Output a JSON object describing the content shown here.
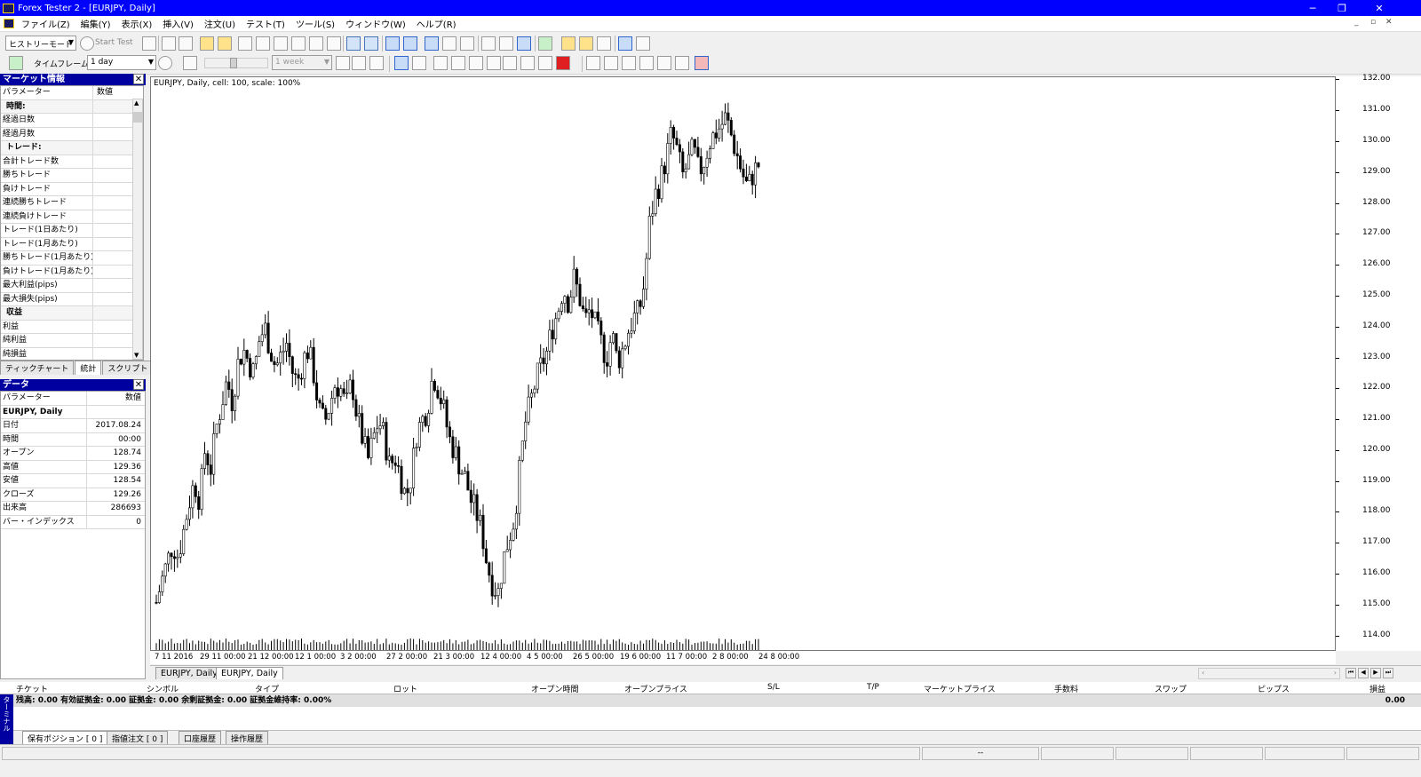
{
  "window": {
    "title": "Forex Tester 2 - [EURJPY, Daily]",
    "minimize": "─",
    "restore": "❐",
    "close": "✕"
  },
  "menu": [
    "ファイル(Z)",
    "編集(Y)",
    "表示(X)",
    "挿入(V)",
    "注文(U)",
    "テスト(T)",
    "ツール(S)",
    "ウィンドウ(W)",
    "ヘルプ(R)"
  ],
  "toolbar": {
    "mode": "ヒストリーモード",
    "start_test": "Start Test",
    "timeframe_label": "タイムフレーム:",
    "timeframe": "1 day",
    "period": "1 week"
  },
  "market_panel": {
    "title": "マーケット情報",
    "col_param": "パラメーター",
    "col_value": "数値",
    "rows": [
      {
        "label": "時間:",
        "section": true
      },
      {
        "label": "経過日数"
      },
      {
        "label": "経過月数"
      },
      {
        "label": "トレード:",
        "section": true
      },
      {
        "label": "合計トレード数"
      },
      {
        "label": "勝ちトレード"
      },
      {
        "label": "負けトレード"
      },
      {
        "label": "連続勝ちトレード"
      },
      {
        "label": "連続負けトレード"
      },
      {
        "label": "トレード(1日あたり)"
      },
      {
        "label": "トレード(1月あたり)"
      },
      {
        "label": "勝ちトレード(1月あたり)"
      },
      {
        "label": "負けトレード(1月あたり)"
      },
      {
        "label": "最大利益(pips)"
      },
      {
        "label": "最大損失(pips)"
      },
      {
        "label": "収益",
        "section": true
      },
      {
        "label": "利益"
      },
      {
        "label": "純利益"
      },
      {
        "label": "純損益"
      }
    ],
    "tabs": [
      "ティックチャート",
      "統計",
      "スクリプト"
    ]
  },
  "data_panel": {
    "title": "データ",
    "col_param": "パラメーター",
    "col_value": "数値",
    "symbol": "EURJPY, Daily",
    "rows": [
      {
        "label": "日付",
        "value": "2017.08.24"
      },
      {
        "label": "時間",
        "value": "00:00"
      },
      {
        "label": "オープン",
        "value": "128.74"
      },
      {
        "label": "高値",
        "value": "129.36"
      },
      {
        "label": "安値",
        "value": "128.54"
      },
      {
        "label": "クローズ",
        "value": "129.26"
      },
      {
        "label": "出来高",
        "value": "286693"
      },
      {
        "label": "バー・インデックス",
        "value": "0"
      }
    ]
  },
  "chart": {
    "header": "EURJPY, Daily, cell: 100, scale: 100%",
    "y_ticks": [
      "132.00",
      "131.00",
      "130.00",
      "129.00",
      "128.00",
      "127.00",
      "126.00",
      "125.00",
      "124.00",
      "123.00",
      "122.00",
      "121.00",
      "120.00",
      "119.00",
      "118.00",
      "117.00",
      "116.00",
      "115.00",
      "114.00"
    ],
    "x_ticks": [
      "7 11 2016",
      "29 11 00:00",
      "21 12 00:00",
      "12 1 00:00",
      "3 2 00:00",
      "27 2 00:00",
      "21 3 00:00",
      "12 4 00:00",
      "4 5 00:00",
      "26 5 00:00",
      "19 6 00:00",
      "11 7 00:00",
      "2 8 00:00",
      "24 8 00:00"
    ],
    "tabs": [
      "EURJPY, Daily",
      "EURJPY, Daily"
    ]
  },
  "chart_data": {
    "type": "candlestick",
    "title": "EURJPY, Daily, cell: 100, scale: 100%",
    "ylim": [
      113.5,
      132.1
    ],
    "x_labels": [
      "7 11 2016",
      "29 11 00:00",
      "21 12 00:00",
      "12 1 00:00",
      "3 2 00:00",
      "27 2 00:00",
      "21 3 00:00",
      "12 4 00:00",
      "4 5 00:00",
      "26 5 00:00",
      "19 6 00:00",
      "11 7 00:00",
      "2 8 00:00",
      "24 8 00:00"
    ],
    "close_series": [
      115.1,
      115.8,
      116.4,
      117.0,
      116.6,
      117.4,
      118.3,
      119.0,
      118.4,
      120.1,
      119.4,
      120.7,
      121.5,
      122.3,
      121.6,
      122.8,
      123.3,
      122.9,
      122.5,
      123.6,
      124.0,
      123.3,
      122.7,
      123.1,
      123.5,
      122.6,
      122.2,
      122.9,
      123.3,
      122.5,
      121.3,
      120.9,
      121.5,
      122.2,
      122.0,
      121.4,
      122.3,
      121.1,
      120.4,
      119.7,
      120.4,
      121.0,
      120.5,
      119.5,
      119.8,
      119.2,
      118.5,
      119.2,
      120.6,
      121.0,
      121.4,
      122.5,
      122.0,
      121.3,
      120.4,
      120.0,
      119.5,
      119.1,
      118.4,
      118.0,
      117.4,
      116.3,
      115.7,
      115.4,
      116.5,
      117.2,
      117.8,
      119.4,
      120.9,
      121.6,
      122.3,
      122.8,
      123.2,
      124.0,
      124.5,
      125.3,
      124.8,
      125.6,
      125.0,
      124.2,
      124.6,
      124.0,
      123.5,
      123.0,
      123.8,
      122.9,
      123.3,
      123.9,
      124.3,
      124.5,
      125.5,
      127.5,
      128.3,
      128.8,
      129.5,
      130.3,
      129.7,
      128.9,
      129.3,
      129.8,
      129.0,
      129.4,
      130.0,
      130.3,
      130.5,
      130.8,
      130.2,
      129.6,
      129.0,
      128.5,
      129.0,
      129.26
    ],
    "volume": "bars",
    "series": [
      {
        "name": "EURJPY, Daily"
      }
    ]
  },
  "terminal": {
    "columns": [
      "チケット",
      "シンボル",
      "タイプ",
      "ロット",
      "オープン時間",
      "オープンプライス",
      "S/L",
      "T/P",
      "マーケットプライス",
      "手数料",
      "スワップ",
      "ピップス",
      "損益"
    ],
    "balance_line": "残高: 0.00 有効証拠金: 0.00 証拠金: 0.00 余剰証拠金: 0.00 証拠金維持率: 0.00%",
    "balance_total": "0.00",
    "tabs": [
      "保有ポジション [ 0 ]",
      "指値注文 [ 0 ]",
      "口座履歴",
      "操作履歴"
    ],
    "side_label": "ターミナル"
  },
  "status": {
    "center": "--"
  }
}
